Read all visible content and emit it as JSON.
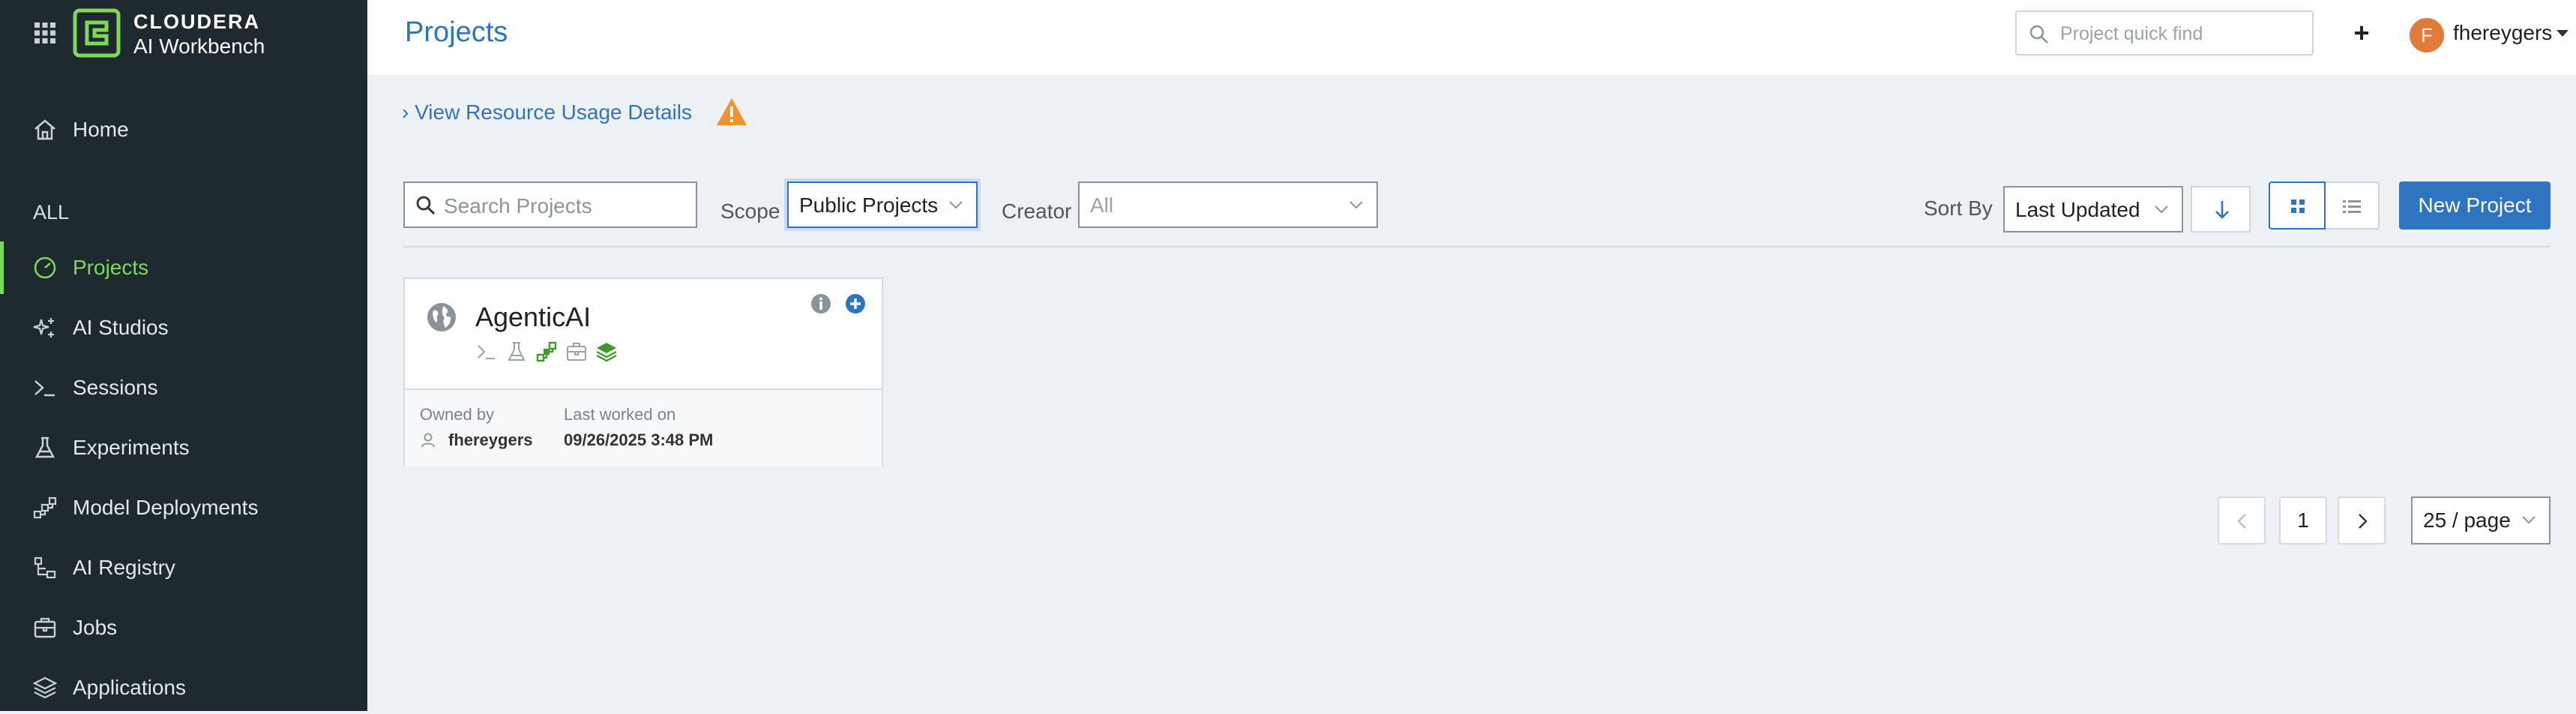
{
  "brand": {
    "line1": "CLOUDERA",
    "line2": "AI Workbench"
  },
  "sidebar": {
    "section_label": "ALL",
    "items": [
      {
        "label": "Home",
        "icon": "home-icon"
      },
      {
        "label": "Projects",
        "icon": "gauge-icon",
        "active": true
      },
      {
        "label": "AI Studios",
        "icon": "sparkle-icon"
      },
      {
        "label": "Sessions",
        "icon": "terminal-icon"
      },
      {
        "label": "Experiments",
        "icon": "flask-icon"
      },
      {
        "label": "Model Deployments",
        "icon": "model-icon"
      },
      {
        "label": "AI Registry",
        "icon": "registry-icon"
      },
      {
        "label": "Jobs",
        "icon": "jobs-icon"
      },
      {
        "label": "Applications",
        "icon": "layers-icon"
      }
    ]
  },
  "header": {
    "title": "Projects",
    "quick_find_placeholder": "Project quick find",
    "add_symbol": "+",
    "user": {
      "initial": "F",
      "name": "fhereygers"
    }
  },
  "resource_link": "View Resource Usage Details",
  "filters": {
    "search_placeholder": "Search Projects",
    "scope_label": "Scope",
    "scope_value": "Public Projects",
    "creator_label": "Creator",
    "creator_value": "All",
    "sort_label": "Sort By",
    "sort_value": "Last Updated",
    "new_project_label": "New Project"
  },
  "projects": [
    {
      "name": "AgenticAI",
      "owned_by_label": "Owned by",
      "owner": "fhereygers",
      "last_worked_label": "Last worked on",
      "last_worked": "09/26/2025 3:48 PM"
    }
  ],
  "pagination": {
    "current_page": "1",
    "per_page": "25 / page"
  },
  "colors": {
    "accent": "#2f74c0",
    "active_nav": "#7ed957",
    "sidebar_bg": "#1f2a30",
    "warning": "#f0922b",
    "avatar": "#e07b39"
  }
}
